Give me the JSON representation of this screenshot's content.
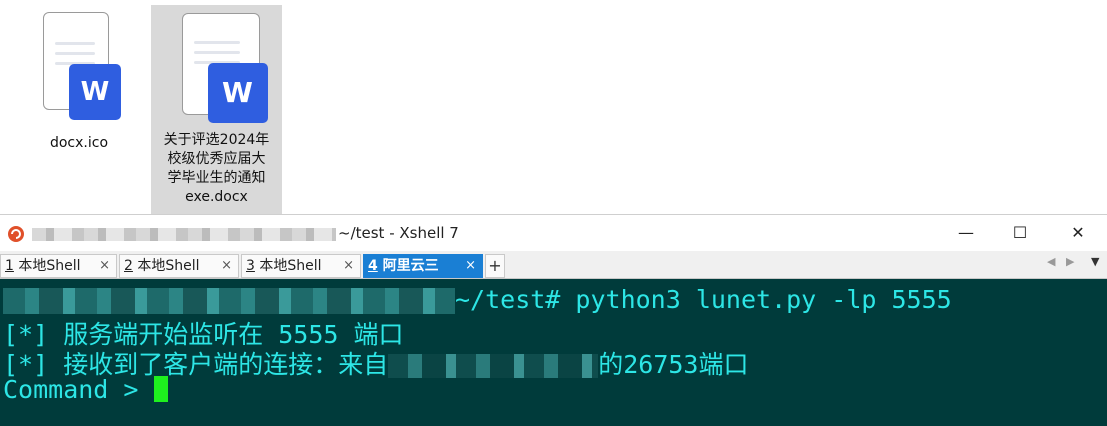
{
  "desktop": {
    "files": [
      {
        "name": "docx.ico",
        "badge": "W",
        "selected": false
      },
      {
        "name": "关于评选2024年校级优秀应届大学毕业生的通知exe.docx",
        "label_lines": [
          "关于评选2024年",
          "校级优秀应届大",
          "学毕业生的通知",
          "exe.docx"
        ],
        "badge": "W",
        "selected": true
      }
    ]
  },
  "window": {
    "title": "~/test - Xshell 7",
    "controls": {
      "minimize": "—",
      "maximize": "☐",
      "close": "✕"
    },
    "tabs": [
      {
        "num": "1",
        "label": "本地Shell",
        "active": false
      },
      {
        "num": "2",
        "label": "本地Shell",
        "active": false
      },
      {
        "num": "3",
        "label": "本地Shell",
        "active": false
      },
      {
        "num": "4",
        "label": "阿里云三",
        "active": true
      }
    ],
    "tab_close": "×",
    "add_tab": "+",
    "nav": {
      "left": "◀",
      "right": "▶",
      "menu": "▼"
    }
  },
  "terminal": {
    "prompt_suffix": "~/test# python3 lunet.py -lp 5555",
    "line2": "[*] 服务端开始监听在 5555 端口",
    "line3_prefix": "[*] 接收到了客户端的连接：来自",
    "line3_suffix": "的26753端口",
    "line4": "Command > "
  },
  "colors": {
    "terminal_bg": "#003b3b",
    "terminal_fg": "#2de6e6",
    "cursor": "#1ef01e",
    "active_tab": "#1a7fd4",
    "word_badge": "#2f5ee0"
  }
}
